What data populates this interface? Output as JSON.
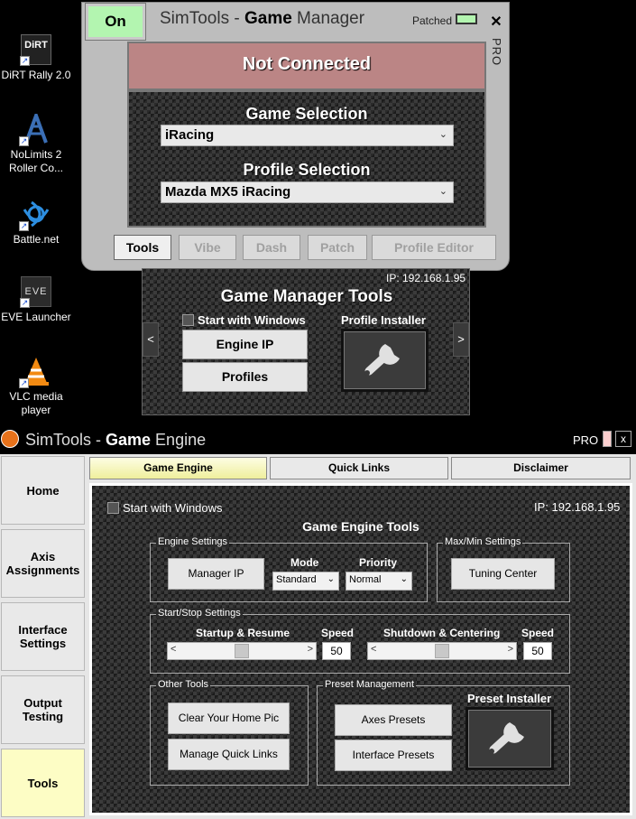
{
  "desktop": {
    "icons": [
      {
        "label": "DiRT Rally 2.0",
        "icon": "dirt-rally-icon",
        "logo_text": "DiRT"
      },
      {
        "label": "NoLimits 2 Roller Co...",
        "icon": "nolimits-icon"
      },
      {
        "label": "Battle.net",
        "icon": "battlenet-icon"
      },
      {
        "label": "EVE Launcher",
        "icon": "eve-icon",
        "logo_text": "EVE"
      },
      {
        "label": "VLC media player",
        "icon": "vlc-icon"
      }
    ]
  },
  "game_manager": {
    "on_label": "On",
    "title_prefix": "SimTools - ",
    "title_bold": "Game",
    "title_suffix": " Manager",
    "patched_label": "Patched",
    "close_label": "✕",
    "pro_label": "PRO",
    "status": "Not Connected",
    "game_selection_label": "Game Selection",
    "game_selection_value": "iRacing",
    "profile_selection_label": "Profile Selection",
    "profile_selection_value": "Mazda MX5 iRacing",
    "tabs": [
      {
        "label": "Tools",
        "state": "active"
      },
      {
        "label": "Vibe",
        "state": "disabled"
      },
      {
        "label": "Dash",
        "state": "disabled"
      },
      {
        "label": "Patch",
        "state": "disabled"
      },
      {
        "label": "Profile Editor",
        "state": "disabled"
      }
    ],
    "tools_panel": {
      "ip": "IP: 192.168.1.95",
      "title": "Game Manager Tools",
      "start_with_windows": "Start with Windows",
      "profile_installer": "Profile Installer",
      "engine_ip_button": "Engine IP",
      "profiles_button": "Profiles",
      "prev_arrow": "<",
      "next_arrow": ">"
    },
    "colors": {
      "on_green": "#b3f5b0",
      "status_red": "#bb8585"
    }
  },
  "game_engine": {
    "title_prefix": "SimTools - ",
    "title_bold": "Game",
    "title_suffix": " Engine",
    "pro_label": "PRO",
    "close_label": "x",
    "sidebar": [
      {
        "label": "Home",
        "active": false
      },
      {
        "label": "Axis Assignments",
        "active": false
      },
      {
        "label": "Interface Settings",
        "active": false
      },
      {
        "label": "Output Testing",
        "active": false
      },
      {
        "label": "Tools",
        "active": true
      }
    ],
    "top_tabs": [
      {
        "label": "Game Engine",
        "active": true
      },
      {
        "label": "Quick Links",
        "active": false
      },
      {
        "label": "Disclaimer",
        "active": false
      }
    ],
    "main": {
      "start_with_windows": "Start with Windows",
      "ip": "IP: 192.168.1.95",
      "title": "Game Engine Tools",
      "engine_settings": {
        "label": "Engine Settings",
        "manager_ip_button": "Manager IP",
        "mode_label": "Mode",
        "mode_value": "Standard",
        "priority_label": "Priority",
        "priority_value": "Normal"
      },
      "maxmin_settings": {
        "label": "Max/Min Settings",
        "tuning_center_button": "Tuning Center"
      },
      "startstop_settings": {
        "label": "Start/Stop Settings",
        "startup_label": "Startup & Resume",
        "startup_speed_label": "Speed",
        "startup_speed_value": "50",
        "shutdown_label": "Shutdown & Centering",
        "shutdown_speed_label": "Speed",
        "shutdown_speed_value": "50",
        "scroll_left": "<",
        "scroll_right": ">"
      },
      "other_tools": {
        "label": "Other Tools",
        "clear_home_pic_button": "Clear Your Home Pic",
        "manage_quick_links_button": "Manage Quick Links"
      },
      "preset_management": {
        "label": "Preset Management",
        "axes_presets_button": "Axes Presets",
        "interface_presets_button": "Interface Presets",
        "preset_installer_label": "Preset Installer"
      }
    },
    "colors": {
      "active_tab": "#fdfdc5",
      "logo_orange": "#e7721b"
    }
  }
}
